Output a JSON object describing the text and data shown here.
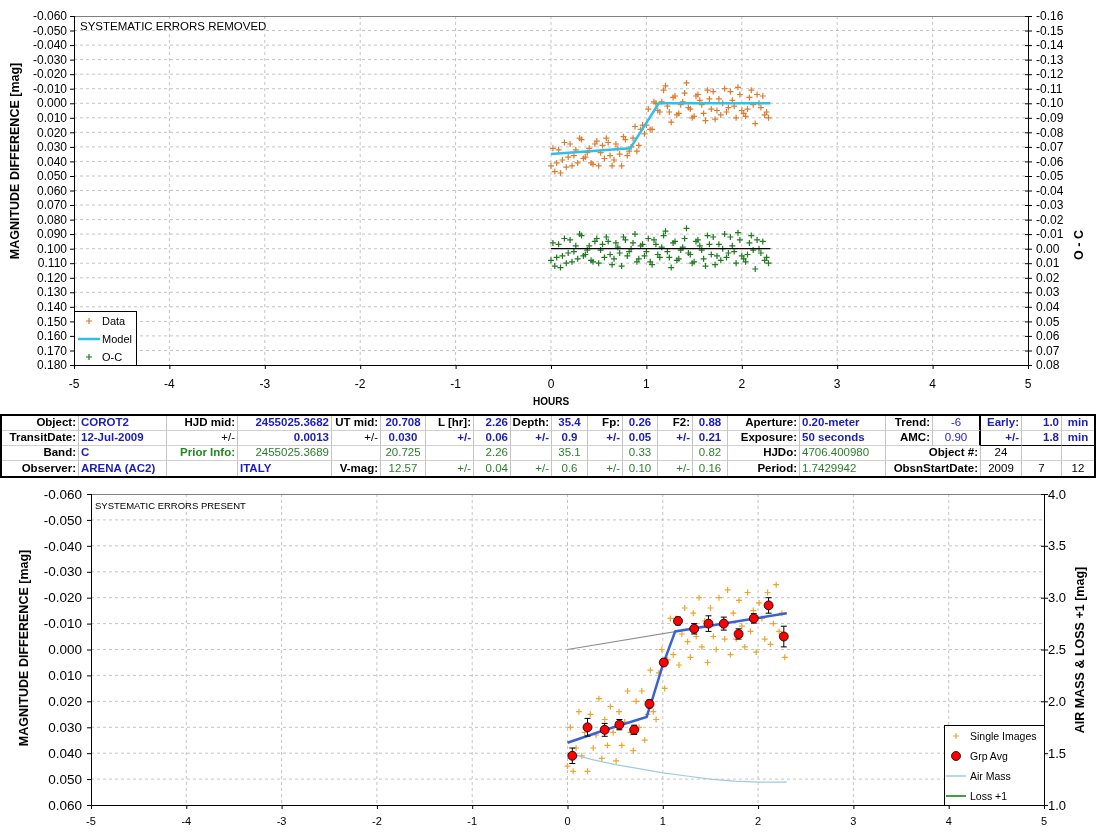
{
  "top_chart": {
    "chart_data": {
      "type": "scatter",
      "title": "SYSTEMATIC ERRORS REMOVED",
      "xlabel": "HOURS",
      "ylabel": "MAGNITUDE DIFFERENCE [mag]",
      "y2label": "O - C",
      "xlim": [
        -5,
        5
      ],
      "ylim": [
        0.18,
        -0.06
      ],
      "y2lim": [
        0.08,
        -0.16
      ],
      "grid": true,
      "legend": true,
      "xticks": [
        -5,
        -4,
        -3,
        -2,
        -1,
        0,
        1,
        2,
        3,
        4,
        5
      ],
      "yticks": [
        {
          "value": -0.06,
          "label": "-0.060"
        },
        {
          "value": -0.05,
          "label": "-0.050"
        },
        {
          "value": -0.04,
          "label": "-0.040"
        },
        {
          "value": -0.03,
          "label": "-0.030"
        },
        {
          "value": -0.02,
          "label": "-0.020"
        },
        {
          "value": -0.01,
          "label": "-0.010"
        },
        {
          "value": 0,
          "label": "0.000"
        },
        {
          "value": 0.01,
          "label": "0.010"
        },
        {
          "value": 0.02,
          "label": "0.020"
        },
        {
          "value": 0.03,
          "label": "0.030"
        },
        {
          "value": 0.04,
          "label": "0.040"
        },
        {
          "value": 0.05,
          "label": "0.050"
        },
        {
          "value": 0.06,
          "label": "0.060"
        },
        {
          "value": 0.07,
          "label": "0.070"
        },
        {
          "value": 0.08,
          "label": "0.080"
        },
        {
          "value": 0.09,
          "label": "0.090"
        },
        {
          "value": 0.1,
          "label": "0.100"
        },
        {
          "value": 0.11,
          "label": "0.110"
        },
        {
          "value": 0.12,
          "label": "0.120"
        },
        {
          "value": 0.13,
          "label": "0.130"
        },
        {
          "value": 0.14,
          "label": "0.140"
        },
        {
          "value": 0.15,
          "label": "0.150"
        },
        {
          "value": 0.16,
          "label": "0.160"
        },
        {
          "value": 0.17,
          "label": "0.170"
        },
        {
          "value": 0.18,
          "label": "0.180"
        }
      ],
      "y2ticks": [
        {
          "value": -0.16,
          "label": "-0.16"
        },
        {
          "value": -0.15,
          "label": "-0.15"
        },
        {
          "value": -0.14,
          "label": "-0.14"
        },
        {
          "value": -0.13,
          "label": "-0.13"
        },
        {
          "value": -0.12,
          "label": "-0.12"
        },
        {
          "value": -0.11,
          "label": "-0.11"
        },
        {
          "value": -0.1,
          "label": "-0.10"
        },
        {
          "value": -0.09,
          "label": "-0.09"
        },
        {
          "value": -0.08,
          "label": "-0.08"
        },
        {
          "value": -0.07,
          "label": "-0.07"
        },
        {
          "value": -0.06,
          "label": "-0.06"
        },
        {
          "value": -0.05,
          "label": "-0.05"
        },
        {
          "value": -0.04,
          "label": "-0.04"
        },
        {
          "value": -0.03,
          "label": "-0.03"
        },
        {
          "value": -0.02,
          "label": "-0.02"
        },
        {
          "value": -0.01,
          "label": "-0.01"
        },
        {
          "value": 0,
          "label": "0.00"
        },
        {
          "value": 0.01,
          "label": "0.01"
        },
        {
          "value": 0.02,
          "label": "0.02"
        },
        {
          "value": 0.03,
          "label": "0.03"
        },
        {
          "value": 0.04,
          "label": "0.04"
        },
        {
          "value": 0.05,
          "label": "0.05"
        },
        {
          "value": 0.06,
          "label": "0.06"
        },
        {
          "value": 0.07,
          "label": "0.07"
        },
        {
          "value": 0.08,
          "label": "0.08"
        }
      ],
      "series": [
        {
          "name": "Data",
          "color": "#e07b2e",
          "type": "scatter",
          "axis": "y",
          "x": [
            0,
            0.04,
            0.08,
            0.12,
            0.16,
            0.2,
            0.24,
            0.28,
            0.32,
            0.36,
            0.4,
            0.44,
            0.48,
            0.52,
            0.56,
            0.6,
            0.64,
            0.68,
            0.72,
            0.76,
            0.8,
            0.84,
            0.88,
            0.92,
            0.96,
            1,
            1.04,
            1.08,
            1.12,
            1.16,
            1.2,
            1.24,
            1.28,
            1.32,
            1.36,
            1.4,
            1.44,
            1.48,
            1.52,
            1.56,
            1.6,
            1.64,
            1.68,
            1.72,
            1.76,
            1.8,
            1.84,
            1.88,
            1.92,
            1.96,
            2,
            2.04,
            2.08,
            2.12,
            2.16,
            2.2,
            2.24,
            2.28,
            0.02,
            0.06,
            0.1,
            0.14,
            0.18,
            0.22,
            0.26,
            0.3,
            0.34,
            0.38,
            0.42,
            0.46,
            0.5,
            0.54,
            0.58,
            0.62,
            0.66,
            0.7,
            0.74,
            0.78,
            0.82,
            0.86,
            0.9,
            0.94,
            0.98,
            1.02,
            1.06,
            1.1,
            1.14,
            1.18,
            1.22,
            1.26,
            1.3,
            1.34,
            1.38,
            1.42,
            1.46,
            1.5,
            1.54,
            1.58,
            1.62,
            1.66,
            1.7,
            1.74,
            1.78,
            1.82,
            1.86,
            1.9,
            1.94,
            1.98,
            2.02,
            2.06,
            2.1,
            2.14,
            2.18,
            2.22,
            2.26
          ],
          "values": [
            0.043,
            0.047,
            0.032,
            0.039,
            0.044,
            0.028,
            0.036,
            0.041,
            0.025,
            0.037,
            0.031,
            0.042,
            0.026,
            0.034,
            0.038,
            0.027,
            0.043,
            0.028,
            0.035,
            0.023,
            0.036,
            0.03,
            0.016,
            0.029,
            0.015,
            0.015,
            0.018,
            -0.001,
            0.005,
            -0.001,
            -0.012,
            0.006,
            -0.004,
            0.008,
            0.001,
            -0.007,
            0.003,
            0.01,
            -0.005,
            -0.002,
            0.007,
            -0.009,
            0.004,
            0.011,
            -0.003,
            0,
            0.006,
            -0.008,
            0.002,
            -0.011,
            0.005,
            0.009,
            -0.004,
            0.001,
            -0.006,
            0.003,
            0.008,
            0.01,
            0.031,
            0.041,
            0.048,
            0.027,
            0.037,
            0.043,
            0.032,
            0.024,
            0.038,
            0.034,
            0.041,
            0.028,
            0.043,
            0.029,
            0.024,
            0.036,
            0.039,
            0.031,
            0.043,
            0.025,
            0.033,
            0.024,
            0.033,
            0.018,
            0.021,
            0.004,
            0.018,
            0,
            0.006,
            -0.009,
            0.002,
            0.013,
            -0.005,
            0.007,
            -0.001,
            -0.014,
            0.004,
            0.009,
            -0.006,
            0.001,
            0.012,
            -0.003,
            -0.008,
            0.005,
            0.008,
            -0.01,
            0.003,
            -0.002,
            0.01,
            -0.006,
            0.007,
            0.004,
            -0.009,
            0.014,
            0,
            -0.005,
            0.006
          ]
        },
        {
          "name": "Model",
          "color": "#2ec0e8",
          "type": "line",
          "axis": "y",
          "x": [
            0,
            0.83,
            1.13,
            2.3
          ],
          "values": [
            0.035,
            0.031,
            0,
            0
          ]
        },
        {
          "name": "O-C",
          "color": "#1e7b1e",
          "type": "scatter",
          "axis": "y2",
          "x": [
            0,
            0.04,
            0.08,
            0.12,
            0.16,
            0.2,
            0.24,
            0.28,
            0.32,
            0.36,
            0.4,
            0.44,
            0.48,
            0.52,
            0.56,
            0.6,
            0.64,
            0.68,
            0.72,
            0.76,
            0.8,
            0.84,
            0.88,
            0.92,
            0.96,
            1,
            1.04,
            1.08,
            1.12,
            1.16,
            1.2,
            1.24,
            1.28,
            1.32,
            1.36,
            1.4,
            1.44,
            1.48,
            1.52,
            1.56,
            1.6,
            1.64,
            1.68,
            1.72,
            1.76,
            1.8,
            1.84,
            1.88,
            1.92,
            1.96,
            2,
            2.04,
            2.08,
            2.12,
            2.16,
            2.2,
            2.24,
            2.28,
            0.02,
            0.06,
            0.1,
            0.14,
            0.18,
            0.22,
            0.26,
            0.3,
            0.34,
            0.38,
            0.42,
            0.46,
            0.5,
            0.54,
            0.58,
            0.62,
            0.66,
            0.7,
            0.74,
            0.78,
            0.82,
            0.86,
            0.9,
            0.94,
            0.98,
            1.02,
            1.06,
            1.1,
            1.14,
            1.18,
            1.22,
            1.26,
            1.3,
            1.34,
            1.38,
            1.42,
            1.46,
            1.5,
            1.54,
            1.58,
            1.62,
            1.66,
            1.7,
            1.74,
            1.78,
            1.82,
            1.86,
            1.9,
            1.94,
            1.98,
            2.02,
            2.06,
            2.1,
            2.14,
            2.18,
            2.22,
            2.26
          ],
          "values": [
            0.008,
            0.012,
            -0.003,
            0.005,
            0.01,
            -0.006,
            0.002,
            0.007,
            -0.009,
            0.004,
            -0.002,
            0.009,
            -0.007,
            0.001,
            0.006,
            -0.005,
            0.011,
            -0.004,
            0.003,
            -0.008,
            0.005,
            0,
            -0.01,
            0.007,
            -0.003,
            0.002,
            0.009,
            -0.006,
            0.004,
            -0.001,
            -0.012,
            0.006,
            -0.004,
            0.008,
            0.001,
            -0.007,
            0.003,
            0.01,
            -0.005,
            -0.002,
            0.007,
            -0.009,
            0.004,
            0.011,
            -0.003,
            0,
            0.006,
            -0.008,
            0.002,
            -0.011,
            0.005,
            0.009,
            -0.004,
            0.001,
            -0.006,
            0.003,
            0.008,
            0.01,
            -0.004,
            0.006,
            0.013,
            -0.007,
            0.003,
            0.009,
            -0.002,
            -0.01,
            0.005,
            0.001,
            0.008,
            -0.005,
            0.01,
            -0.003,
            -0.008,
            0.004,
            0.007,
            -0.001,
            0.012,
            -0.006,
            0.002,
            -0.004,
            0.009,
            -0.002,
            0.005,
            -0.007,
            0.011,
            -0.003,
            0.006,
            -0.009,
            0.002,
            0.013,
            -0.005,
            0.007,
            -0.001,
            -0.014,
            0.004,
            0.009,
            -0.006,
            0.001,
            0.012,
            -0.003,
            -0.008,
            0.005,
            0.008,
            -0.01,
            0.003,
            -0.002,
            0.01,
            -0.006,
            0.007,
            0.004,
            -0.009,
            0.014,
            0,
            -0.005,
            0.006
          ]
        },
        {
          "color": "#000000",
          "type": "line",
          "axis": "y2",
          "x": [
            0,
            2.3
          ],
          "values": [
            0,
            0
          ]
        }
      ]
    }
  },
  "parameters_table": {
    "rows": [
      [
        {
          "text": "Object:",
          "kind": "label"
        },
        {
          "text": "COROT2",
          "kind": "name"
        },
        {
          "text": "HJD mid:",
          "kind": "label"
        },
        {
          "text": "2455025.3682",
          "kind": "result"
        },
        {
          "text": "UT mid:",
          "kind": "label"
        },
        {
          "text": "20.708",
          "kind": "result"
        },
        {
          "text": "L [hr]:",
          "kind": "label"
        },
        {
          "text": "2.26",
          "kind": "result"
        },
        {
          "text": "Depth:",
          "kind": "label"
        },
        {
          "text": "35.4",
          "kind": "result"
        },
        {
          "text": "Fp:",
          "kind": "label"
        },
        {
          "text": "0.26",
          "kind": "result"
        },
        {
          "text": "F2:",
          "kind": "label"
        },
        {
          "text": "0.88",
          "kind": "result"
        },
        {
          "text": "Aperture:",
          "kind": "label"
        },
        {
          "text": "0.20-meter",
          "kind": "name"
        },
        {
          "text": "Trend:",
          "kind": "label"
        },
        {
          "text": "-6",
          "kind": "setting"
        },
        {
          "text": "Early:",
          "kind": "result_label"
        },
        {
          "text": "1.0",
          "kind": "result"
        },
        {
          "text": "min",
          "kind": "unit"
        }
      ],
      [
        {
          "text": "TransitDate:",
          "kind": "label"
        },
        {
          "text": "12-Jul-2009",
          "kind": "name"
        },
        {
          "text": "+/-",
          "kind": "label_light"
        },
        {
          "text": "0.0013",
          "kind": "result"
        },
        {
          "text": "+/-",
          "kind": "label_light"
        },
        {
          "text": "0.030",
          "kind": "result"
        },
        {
          "text": "+/-",
          "kind": "result_label"
        },
        {
          "text": "0.06",
          "kind": "result"
        },
        {
          "text": "+/-",
          "kind": "result_label"
        },
        {
          "text": "0.9",
          "kind": "result"
        },
        {
          "text": "+/-",
          "kind": "result_label"
        },
        {
          "text": "0.05",
          "kind": "result"
        },
        {
          "text": "+/-",
          "kind": "result_label"
        },
        {
          "text": "0.21",
          "kind": "result"
        },
        {
          "text": "Exposure:",
          "kind": "label"
        },
        {
          "text": "50 seconds",
          "kind": "name"
        },
        {
          "text": "AMC:",
          "kind": "label"
        },
        {
          "text": "0.90",
          "kind": "setting"
        },
        {
          "text": "+/-",
          "kind": "result_label"
        },
        {
          "text": "1.8",
          "kind": "result"
        },
        {
          "text": "min",
          "kind": "unit"
        }
      ],
      [
        {
          "text": "Band:",
          "kind": "label"
        },
        {
          "text": "C",
          "kind": "name"
        },
        {
          "text": "Prior Info:",
          "kind": "prior_label"
        },
        {
          "text": "2455025.3689",
          "kind": "prior"
        },
        "",
        {
          "text": "20.725",
          "kind": "prior"
        },
        "",
        {
          "text": "2.26",
          "kind": "prior"
        },
        "",
        {
          "text": "35.1",
          "kind": "prior"
        },
        "",
        {
          "text": "0.33",
          "kind": "prior"
        },
        "",
        {
          "text": "0.82",
          "kind": "prior"
        },
        {
          "text": "HJDo:",
          "kind": "label"
        },
        {
          "text": "4706.400980",
          "kind": "prior"
        },
        "",
        {
          "text": "Object #:",
          "kind": "label"
        },
        {
          "text": "24",
          "kind": "info"
        },
        "",
        ""
      ],
      [
        {
          "text": "Observer:",
          "kind": "label"
        },
        {
          "text": "ARENA (AC2)",
          "kind": "name"
        },
        "",
        {
          "text": "ITALY",
          "kind": "name"
        },
        {
          "text": "V-mag:",
          "kind": "label"
        },
        {
          "text": "12.57",
          "kind": "prior"
        },
        {
          "text": "+/-",
          "kind": "prior_key"
        },
        {
          "text": "0.04",
          "kind": "prior"
        },
        {
          "text": "+/-",
          "kind": "prior_key"
        },
        {
          "text": "0.6",
          "kind": "prior"
        },
        {
          "text": "+/-",
          "kind": "prior_key"
        },
        {
          "text": "0.10",
          "kind": "prior"
        },
        {
          "text": "+/-",
          "kind": "prior_key"
        },
        {
          "text": "0.16",
          "kind": "prior"
        },
        {
          "text": "Period:",
          "kind": "label"
        },
        {
          "text": "1.7429942",
          "kind": "prior"
        },
        "",
        {
          "text": "ObsnStartDate:",
          "kind": "label"
        },
        {
          "text": "2009",
          "kind": "info"
        },
        {
          "text": "7",
          "kind": "info"
        },
        {
          "text": "12",
          "kind": "info"
        }
      ]
    ]
  },
  "bottom_chart": {
    "chart_data": {
      "type": "scatter",
      "title": "SYSTEMATIC ERRORS PRESENT",
      "ylabel": "MAGNITUDE DIFFERENCE [mag]",
      "y2label": "AIR MASS & LOSS +1 [mag]",
      "xlim": [
        -5,
        5
      ],
      "ylim": [
        0.06,
        -0.06
      ],
      "y2lim": [
        1,
        4
      ],
      "grid": true,
      "legend": true,
      "xticks": [
        -5,
        -4,
        -3,
        -2,
        -1,
        0,
        1,
        2,
        3,
        4,
        5
      ],
      "yticks": [
        {
          "value": -0.06,
          "label": "-0.060"
        },
        {
          "value": -0.05,
          "label": "-0.050"
        },
        {
          "value": -0.04,
          "label": "-0.040"
        },
        {
          "value": -0.03,
          "label": "-0.030"
        },
        {
          "value": -0.02,
          "label": "-0.020"
        },
        {
          "value": -0.01,
          "label": "-0.010"
        },
        {
          "value": 0,
          "label": "0.000"
        },
        {
          "value": 0.01,
          "label": "0.010"
        },
        {
          "value": 0.02,
          "label": "0.020"
        },
        {
          "value": 0.03,
          "label": "0.030"
        },
        {
          "value": 0.04,
          "label": "0.040"
        },
        {
          "value": 0.05,
          "label": "0.050"
        },
        {
          "value": 0.06,
          "label": "0.060"
        }
      ],
      "y2ticks": [
        {
          "value": 1,
          "label": "1.0"
        },
        {
          "value": 1.5,
          "label": "1.5"
        },
        {
          "value": 2,
          "label": "2.0"
        },
        {
          "value": 2.5,
          "label": "2.5"
        },
        {
          "value": 3,
          "label": "3.0"
        },
        {
          "value": 3.5,
          "label": "3.5"
        },
        {
          "value": 4,
          "label": "4.0"
        }
      ],
      "series": [
        {
          "name": "Single Images",
          "color": "#f0a42c",
          "type": "scatter",
          "axis": "y",
          "x": [
            0,
            0.03,
            0.06,
            0.09,
            0.12,
            0.15,
            0.18,
            0.21,
            0.24,
            0.27,
            0.3,
            0.33,
            0.36,
            0.39,
            0.42,
            0.45,
            0.48,
            0.51,
            0.54,
            0.57,
            0.6,
            0.63,
            0.66,
            0.69,
            0.72,
            0.75,
            0.78,
            0.81,
            0.84,
            0.87,
            0.9,
            0.93,
            0.96,
            0.99,
            1.02,
            1.05,
            1.08,
            1.11,
            1.14,
            1.17,
            1.2,
            1.23,
            1.26,
            1.29,
            1.32,
            1.35,
            1.38,
            1.41,
            1.44,
            1.47,
            1.5,
            1.53,
            1.56,
            1.59,
            1.62,
            1.65,
            1.68,
            1.71,
            1.74,
            1.77,
            1.8,
            1.83,
            1.86,
            1.89,
            1.92,
            1.95,
            1.98,
            2.01,
            2.04,
            2.07,
            2.1,
            2.13,
            2.16,
            2.19,
            2.22,
            2.25,
            2.28
          ],
          "values": [
            0.045,
            0.03,
            0.047,
            0.038,
            0.024,
            0.041,
            0.032,
            0.047,
            0.025,
            0.038,
            0.033,
            0.019,
            0.042,
            0.027,
            0.037,
            0.022,
            0.032,
            0.043,
            0.024,
            0.037,
            0.028,
            0.016,
            0.032,
            0.039,
            0.02,
            0.03,
            0.016,
            0.035,
            0.025,
            0.008,
            0.024,
            0.027,
            0.009,
            0,
            0.015,
            0.004,
            -0.012,
            0.002,
            -0.012,
            0.006,
            -0.006,
            -0.016,
            -0.003,
            0.003,
            -0.014,
            -0.005,
            -0.02,
            -0.001,
            -0.011,
            0.005,
            -0.016,
            -0.005,
            0,
            -0.02,
            -0.009,
            -0.004,
            -0.023,
            0.002,
            -0.014,
            -0.004,
            -0.019,
            -0.009,
            -0.001,
            -0.022,
            -0.007,
            -0.015,
            0.001,
            -0.018,
            -0.012,
            -0.004,
            -0.022,
            -0.002,
            -0.01,
            -0.025,
            -0.007,
            -0.014,
            0.003
          ]
        },
        {
          "name": "Grp Avg",
          "color": "#ff0000",
          "type": "scatter",
          "axis": "y",
          "x": [
            0.05,
            0.21,
            0.39,
            0.545,
            0.7,
            0.86,
            1.01,
            1.16,
            1.33,
            1.48,
            1.64,
            1.795,
            1.955,
            2.11,
            2.27
          ],
          "values": [
            0.041,
            0.03,
            0.031,
            0.029,
            0.031,
            0.021,
            0.005,
            -0.011,
            -0.008,
            -0.01,
            -0.01,
            -0.006,
            -0.012,
            -0.017,
            -0.005
          ],
          "errors": [
            0.003,
            0.0034,
            0.0025,
            0.002,
            0.0018,
            0.0015,
            0.0012,
            0.0015,
            0.002,
            0.003,
            0.0025,
            0.002,
            0.0018,
            0.003,
            0.004
          ]
        },
        {
          "name": "Air Mass",
          "color": "#9ecae9",
          "type": "line",
          "axis": "y2",
          "x": [
            0,
            0.25,
            0.5,
            0.75,
            1,
            1.25,
            1.5,
            1.75,
            2,
            2.3
          ],
          "values": [
            1.5,
            1.44,
            1.39,
            1.35,
            1.31,
            1.28,
            1.25,
            1.23,
            1.22,
            1.22
          ]
        },
        {
          "name": "Loss +1",
          "color": "#008000",
          "type": "line",
          "axis": "y2"
        },
        {
          "color": "#8c8c8c",
          "type": "line",
          "axis": "y",
          "x": [
            0,
            2.3
          ],
          "values": [
            0,
            -0.014
          ]
        },
        {
          "color": "#3a62d6",
          "type": "line",
          "axis": "y",
          "x": [
            0,
            0.4,
            0.83,
            0.9,
            1,
            1.13,
            2.3
          ],
          "values": [
            0.036,
            0.031,
            0.026,
            0.018,
            0.006,
            -0.007,
            -0.014
          ]
        }
      ]
    }
  }
}
